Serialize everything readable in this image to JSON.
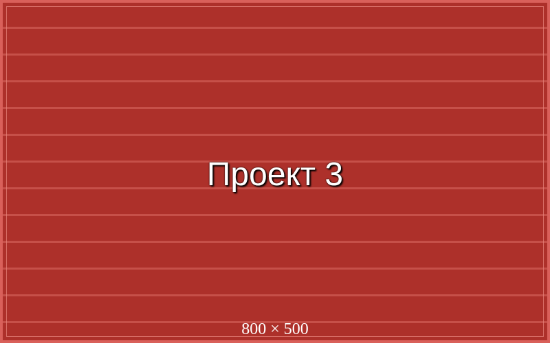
{
  "placeholder": {
    "title": "Проект 3",
    "dimensions_label": "800 × 500"
  },
  "colors": {
    "background": "#ad302a",
    "border": "#d9605a",
    "stripe": "#c65049",
    "text": "#ffffff"
  }
}
